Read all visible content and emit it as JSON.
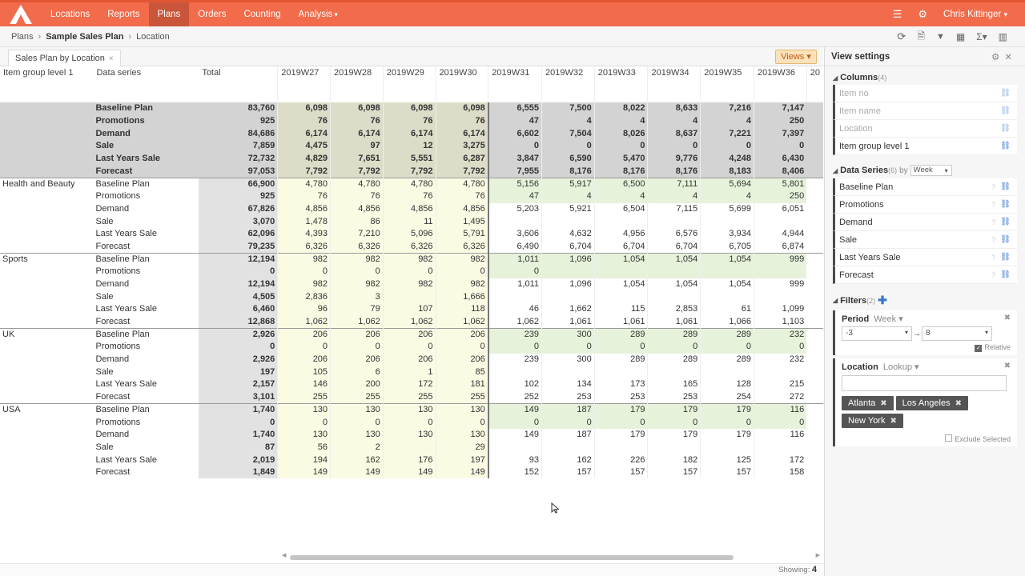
{
  "nav": {
    "items": [
      "Locations",
      "Reports",
      "Plans",
      "Orders",
      "Counting",
      "Analysis"
    ],
    "active": "Plans",
    "analysis_caret": "▾",
    "user": "Chris Kittinger",
    "user_caret": "▾"
  },
  "breadcrumb": {
    "root": "Plans",
    "plan": "Sample Sales Plan",
    "current": "Location"
  },
  "tab": {
    "label": "Sales Plan by Location",
    "close": "×"
  },
  "views_button": "Views ▾",
  "grid": {
    "headers": [
      "Item group level 1",
      "Data series",
      "Total",
      "2019W27",
      "2019W28",
      "2019W29",
      "2019W30",
      "2019W31",
      "2019W32",
      "2019W33",
      "2019W34",
      "2019W35",
      "2019W36",
      "20"
    ],
    "groups": [
      {
        "name": "",
        "total": true,
        "rows": [
          {
            "series": "Baseline Plan",
            "total": "83,760",
            "w": [
              "6,098",
              "6,098",
              "6,098",
              "6,098",
              "6,555",
              "7,500",
              "8,022",
              "8,633",
              "7,216",
              "7,147"
            ]
          },
          {
            "series": "Promotions",
            "total": "925",
            "w": [
              "76",
              "76",
              "76",
              "76",
              "47",
              "4",
              "4",
              "4",
              "4",
              "250"
            ]
          },
          {
            "series": "Demand",
            "total": "84,686",
            "w": [
              "6,174",
              "6,174",
              "6,174",
              "6,174",
              "6,602",
              "7,504",
              "8,026",
              "8,637",
              "7,221",
              "7,397"
            ]
          },
          {
            "series": "Sale",
            "total": "7,859",
            "w": [
              "4,475",
              "97",
              "12",
              "3,275",
              "0",
              "0",
              "0",
              "0",
              "0",
              "0"
            ]
          },
          {
            "series": "Last Years Sale",
            "total": "72,732",
            "w": [
              "4,829",
              "7,651",
              "5,551",
              "6,287",
              "3,847",
              "6,590",
              "5,470",
              "9,776",
              "4,248",
              "6,430"
            ]
          },
          {
            "series": "Forecast",
            "total": "97,053",
            "w": [
              "7,792",
              "7,792",
              "7,792",
              "7,792",
              "7,955",
              "8,176",
              "8,176",
              "8,176",
              "8,183",
              "8,406"
            ]
          }
        ]
      },
      {
        "name": "Health and Beauty",
        "rows": [
          {
            "series": "Baseline Plan",
            "total": "66,900",
            "w": [
              "4,780",
              "4,780",
              "4,780",
              "4,780",
              "5,156",
              "5,917",
              "6,500",
              "7,111",
              "5,694",
              "5,801"
            ]
          },
          {
            "series": "Promotions",
            "total": "925",
            "w": [
              "76",
              "76",
              "76",
              "76",
              "47",
              "4",
              "4",
              "4",
              "4",
              "250"
            ]
          },
          {
            "series": "Demand",
            "total": "67,826",
            "w": [
              "4,856",
              "4,856",
              "4,856",
              "4,856",
              "5,203",
              "5,921",
              "6,504",
              "7,115",
              "5,699",
              "6,051"
            ]
          },
          {
            "series": "Sale",
            "total": "3,070",
            "w": [
              "1,478",
              "86",
              "11",
              "1,495",
              "",
              "",
              "",
              "",
              "",
              ""
            ]
          },
          {
            "series": "Last Years Sale",
            "total": "62,096",
            "w": [
              "4,393",
              "7,210",
              "5,096",
              "5,791",
              "3,606",
              "4,632",
              "4,956",
              "6,576",
              "3,934",
              "4,944"
            ]
          },
          {
            "series": "Forecast",
            "total": "79,235",
            "w": [
              "6,326",
              "6,326",
              "6,326",
              "6,326",
              "6,490",
              "6,704",
              "6,704",
              "6,704",
              "6,705",
              "6,874"
            ]
          }
        ]
      },
      {
        "name": "Sports",
        "rows": [
          {
            "series": "Baseline Plan",
            "total": "12,194",
            "w": [
              "982",
              "982",
              "982",
              "982",
              "1,011",
              "1,096",
              "1,054",
              "1,054",
              "1,054",
              "999"
            ]
          },
          {
            "series": "Promotions",
            "total": "0",
            "w": [
              "0",
              "0",
              "0",
              "0",
              "0",
              "",
              "",
              "",
              "",
              ""
            ]
          },
          {
            "series": "Demand",
            "total": "12,194",
            "w": [
              "982",
              "982",
              "982",
              "982",
              "1,011",
              "1,096",
              "1,054",
              "1,054",
              "1,054",
              "999"
            ]
          },
          {
            "series": "Sale",
            "total": "4,505",
            "w": [
              "2,836",
              "3",
              "",
              "1,666",
              "",
              "",
              "",
              "",
              "",
              ""
            ]
          },
          {
            "series": "Last Years Sale",
            "total": "6,460",
            "w": [
              "96",
              "79",
              "107",
              "118",
              "46",
              "1,662",
              "115",
              "2,853",
              "61",
              "1,099"
            ]
          },
          {
            "series": "Forecast",
            "total": "12,868",
            "w": [
              "1,062",
              "1,062",
              "1,062",
              "1,062",
              "1,062",
              "1,061",
              "1,061",
              "1,061",
              "1,066",
              "1,103"
            ]
          }
        ]
      },
      {
        "name": "UK",
        "rows": [
          {
            "series": "Baseline Plan",
            "total": "2,926",
            "w": [
              "206",
              "206",
              "206",
              "206",
              "239",
              "300",
              "289",
              "289",
              "289",
              "232"
            ]
          },
          {
            "series": "Promotions",
            "total": "0",
            "w": [
              "0",
              "0",
              "0",
              "0",
              "0",
              "0",
              "0",
              "0",
              "0",
              "0"
            ]
          },
          {
            "series": "Demand",
            "total": "2,926",
            "w": [
              "206",
              "206",
              "206",
              "206",
              "239",
              "300",
              "289",
              "289",
              "289",
              "232"
            ]
          },
          {
            "series": "Sale",
            "total": "197",
            "w": [
              "105",
              "6",
              "1",
              "85",
              "",
              "",
              "",
              "",
              "",
              ""
            ]
          },
          {
            "series": "Last Years Sale",
            "total": "2,157",
            "w": [
              "146",
              "200",
              "172",
              "181",
              "102",
              "134",
              "173",
              "165",
              "128",
              "215"
            ]
          },
          {
            "series": "Forecast",
            "total": "3,101",
            "w": [
              "255",
              "255",
              "255",
              "255",
              "252",
              "253",
              "253",
              "253",
              "254",
              "272"
            ]
          }
        ]
      },
      {
        "name": "USA",
        "rows": [
          {
            "series": "Baseline Plan",
            "total": "1,740",
            "w": [
              "130",
              "130",
              "130",
              "130",
              "149",
              "187",
              "179",
              "179",
              "179",
              "116"
            ]
          },
          {
            "series": "Promotions",
            "total": "0",
            "w": [
              "0",
              "0",
              "0",
              "0",
              "0",
              "0",
              "0",
              "0",
              "0",
              "0"
            ]
          },
          {
            "series": "Demand",
            "total": "1,740",
            "w": [
              "130",
              "130",
              "130",
              "130",
              "149",
              "187",
              "179",
              "179",
              "179",
              "116"
            ]
          },
          {
            "series": "Sale",
            "total": "87",
            "w": [
              "56",
              "2",
              "",
              "29",
              "",
              "",
              "",
              "",
              "",
              ""
            ]
          },
          {
            "series": "Last Years Sale",
            "total": "2,019",
            "w": [
              "194",
              "162",
              "176",
              "197",
              "93",
              "162",
              "226",
              "182",
              "125",
              "172"
            ]
          },
          {
            "series": "Forecast",
            "total": "1,849",
            "w": [
              "149",
              "149",
              "149",
              "149",
              "152",
              "157",
              "157",
              "157",
              "157",
              "158"
            ]
          }
        ]
      }
    ]
  },
  "status": {
    "showing_label": "Showing:",
    "showing_count": "4"
  },
  "view_settings": {
    "title": "View settings",
    "columns": {
      "title": "Columns",
      "count": "(4)",
      "items": [
        "Item no",
        "Item name",
        "Location",
        "Item group level 1"
      ]
    },
    "data_series": {
      "title": "Data Series",
      "count": "(6)",
      "by": "by",
      "by_value": "Week",
      "items": [
        "Baseline Plan",
        "Promotions",
        "Demand",
        "Sale",
        "Last Years Sale",
        "Forecast"
      ]
    },
    "filters": {
      "title": "Filters",
      "count": "(2)",
      "period": {
        "label": "Period",
        "type": "Week ▾",
        "from": "-3",
        "to": "8",
        "relative": "Relative"
      },
      "location": {
        "label": "Location",
        "type": "Lookup ▾",
        "chips": [
          "Atlanta",
          "Los Angeles",
          "New York"
        ],
        "exclude": "Exclude Selected"
      }
    }
  },
  "colors": {
    "brand": "#f26b4a",
    "summary_bg": "#d3d3d3",
    "past_bg": "#fbfbe4",
    "future_bg": "#e6f2da",
    "total_col_bg": "#e2e2e2"
  }
}
